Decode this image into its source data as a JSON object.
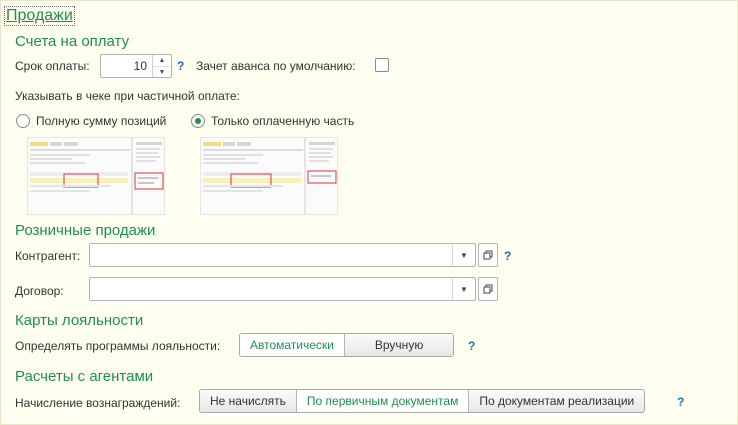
{
  "page": {
    "title": "Продажи"
  },
  "invoices": {
    "heading": "Счета на оплату",
    "term_label": "Срок оплаты:",
    "term_value": "10",
    "help": "?",
    "advance_label": "Зачет аванса по умолчанию:",
    "advance_checked": false,
    "receipt_label": "Указывать в чеке при частичной оплате:",
    "options": [
      {
        "label": "Полную сумму позиций",
        "selected": false
      },
      {
        "label": "Только оплаченную часть",
        "selected": true
      }
    ]
  },
  "retail": {
    "heading": "Розничные продажи",
    "counterparty_label": "Контрагент:",
    "counterparty_value": "",
    "contract_label": "Договор:",
    "contract_value": "",
    "help": "?"
  },
  "loyalty": {
    "heading": "Карты лояльности",
    "label": "Определять программы лояльности:",
    "buttons": [
      {
        "label": "Автоматически",
        "selected": true
      },
      {
        "label": "Вручную",
        "selected": false
      }
    ],
    "help": "?"
  },
  "agents": {
    "heading": "Расчеты с агентами",
    "label": "Начисление вознаграждений:",
    "buttons": [
      {
        "label": "Не начислять",
        "selected": false
      },
      {
        "label": "По первичным документам",
        "selected": true
      },
      {
        "label": "По документам реализации",
        "selected": false
      }
    ],
    "help": "?"
  },
  "colors": {
    "accent": "#1e8f4e",
    "help": "#1a6fb5",
    "background": "#fffff0"
  }
}
